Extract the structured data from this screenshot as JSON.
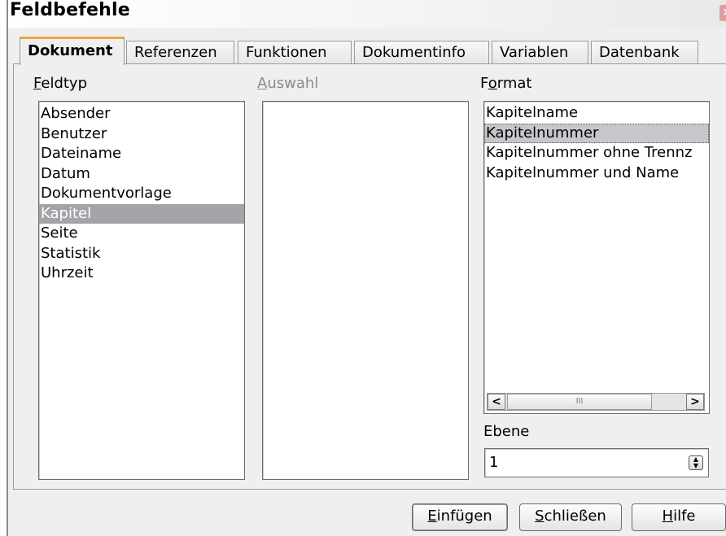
{
  "window": {
    "title": "Feldbefehle"
  },
  "tabs": [
    "Dokument",
    "Referenzen",
    "Funktionen",
    "Dokumentinfo",
    "Variablen",
    "Datenbank"
  ],
  "feldtyp": {
    "label_first": "F",
    "label_rest": "eldtyp",
    "items": [
      "Absender",
      "Benutzer",
      "Dateiname",
      "Datum",
      "Dokumentvorlage",
      "Kapitel",
      "Seite",
      "Statistik",
      "Uhrzeit"
    ],
    "selected": "Kapitel"
  },
  "auswahl": {
    "label_first": "A",
    "label_rest": "uswahl"
  },
  "format": {
    "label_a": "F",
    "label_u": "o",
    "label_b": "rmat",
    "items": [
      "Kapitelname",
      "Kapitelnummer",
      "Kapitelnummer ohne Trennz",
      "Kapitelnummer und Name"
    ],
    "selected": "Kapitelnummer",
    "scroll_left": "<",
    "scroll_right": ">",
    "scroll_grip": "III"
  },
  "ebene": {
    "label": "Ebene",
    "value": "1"
  },
  "buttons": {
    "insert_u": "E",
    "insert_rest": "infügen",
    "close_u": "S",
    "close_rest": "chließen",
    "help_u": "H",
    "help_rest": "ilfe"
  },
  "colors": {
    "tab_accent": "#f1a441",
    "selection": "#a3a3a8"
  }
}
